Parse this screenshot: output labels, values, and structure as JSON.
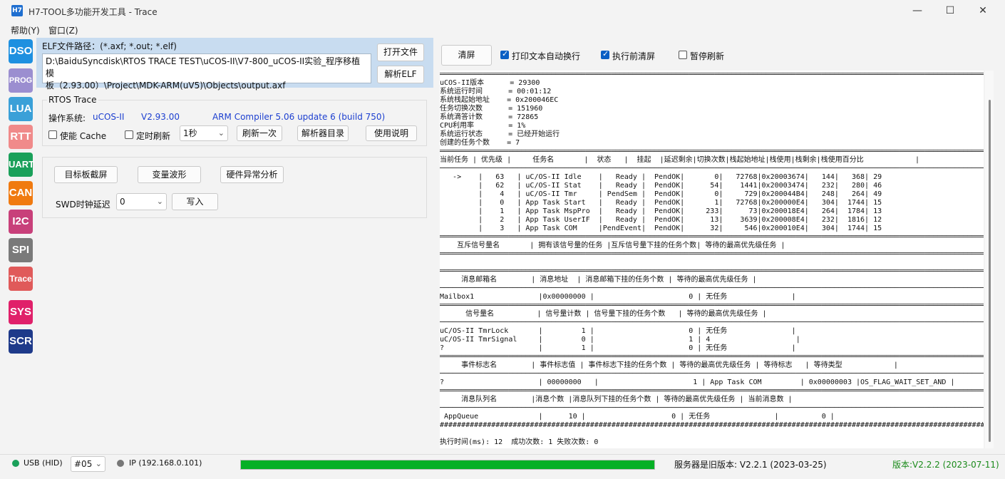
{
  "window": {
    "app_icon": "H7",
    "title": "H7-TOOL多功能开发工具 - Trace",
    "minimize_icon": "minimize-icon",
    "maximize_icon": "maximize-icon",
    "close_icon": "close-icon"
  },
  "menu": [
    "帮助(Y)",
    "窗口(Z)"
  ],
  "sidebar": [
    {
      "label": "DSO",
      "color": "#1e90e0"
    },
    {
      "label": "PROG",
      "color": "#9b8ed0"
    },
    {
      "label": "LUA",
      "color": "#3aa0d8"
    },
    {
      "label": "RTT",
      "color": "#f08a8a"
    },
    {
      "label": "UART",
      "color": "#1aa05a"
    },
    {
      "label": "CAN",
      "color": "#f07a10"
    },
    {
      "label": "I2C",
      "color": "#c8407a"
    },
    {
      "label": "SPI",
      "color": "#7a7a7a"
    },
    {
      "label": "Trace",
      "color": "#e05a5a"
    },
    {
      "label": "SYS",
      "color": "#e0206a"
    },
    {
      "label": "SCR",
      "color": "#1e3a8a"
    }
  ],
  "elf": {
    "label": "ELF文件路径：(*.axf; *.out; *.elf)",
    "path_line1": "D:\\BaiduSyncdisk\\RTOS TRACE TEST\\uCOS-II\\V7-800_uCOS-II实验_程序移植模",
    "path_line2": "板（2.93.00）\\Project\\MDK-ARM(uV5)\\Objects\\output.axf",
    "open_button": "打开文件",
    "parse_button": "解析ELF"
  },
  "rtos": {
    "group_title": "RTOS Trace",
    "os_label": "操作系统:",
    "os_name": "uCOS-II",
    "os_version": "V2.93.00",
    "compiler": "ARM Compiler 5.06 update 6 (build 750)",
    "cache_label": "使能 Cache",
    "timer_label": "定时刷新",
    "interval": "1秒",
    "refresh_button": "刷新一次",
    "parser_dir_button": "解析器目录",
    "help_button": "使用说明"
  },
  "tools": {
    "screenshot_button": "目标板截屏",
    "waveform_button": "变量波形",
    "hardfault_button": "硬件异常分析",
    "swd_label": "SWD时钟延迟",
    "swd_value": "0",
    "write_button": "写入"
  },
  "right_toolbar": {
    "clear_button": "清屏",
    "wrap_label": "打印文本自动换行",
    "wrap_checked": true,
    "clear_before_label": "执行前清屏",
    "clear_before_checked": true,
    "pause_label": "暂停刷新",
    "pause_checked": false
  },
  "console": {
    "lines": [
      "════════════════════════════════════════════════════════════════════════════════════════════════════════════════════════════════════",
      "uCOS-II版本      = 29300",
      "系统运行时间      = 00:01:12",
      "系统栈起始地址    = 0x200046EC",
      "任务切换次数      = 151960",
      "系统滴答计数      = 72865",
      "CPU利用率        = 1%",
      "系统运行状态      = 已经开始运行",
      "创建的任务个数    = 7",
      "════════════════════════════════════════════════════════════════════════════════════════════════════════════════════════════════════",
      "当前任务 | 优先级 |     任务名       |  状态   |  挂起  |延迟剩余|切换次数|栈起始地址|栈使用|栈剩余|栈使用百分比            |",
      "────────────────────────────────────────────────────────────────────────────────────────────────────────────────────────────────────",
      "   ->    |   63   | uC/OS-II Idle    |   Ready |  PendOK|       0|   72768|0x20003674|   144|   368| 29",
      "         |   62   | uC/OS-II Stat    |   Ready |  PendOK|      54|    1441|0x20003474|   232|   280| 46",
      "         |    4   | uC/OS-II Tmr     | PendSem |  PendOK|       0|     729|0x200044B4|   248|   264| 49",
      "         |    0   | App Task Start   |   Ready |  PendOK|       1|   72768|0x200000E4|   304|  1744| 15",
      "         |    1   | App Task MspPro  |   Ready |  PendOK|     233|      73|0x200018E4|   264|  1784| 13",
      "         |    2   | App Task UserIF  |   Ready |  PendOK|      13|    3639|0x200008E4|   232|  1816| 12",
      "         |    3   | App Task COM     |PendEvent|  PendOK|      32|     546|0x200010E4|   304|  1744| 15",
      "════════════════════════════════════════════════════════════════════════════════════════════════════════════════════════════════════",
      "    互斥信号量名       | 拥有该信号量的任务 |互斥信号量下挂的任务个数| 等待的最高优先级任务 |",
      "════════════════════════════════════════════════════════════════════════════════════════════════════════════════════════════════════",
      "",
      "════════════════════════════════════════════════════════════════════════════════════════════════════════════════════════════════════",
      "     消息邮箱名        | 消息地址  | 消息邮箱下挂的任务个数 | 等待的最高优先级任务 |",
      "────────────────────────────────────────────────────────────────────────────────────────────────────────────────────────────────────",
      "Mailbox1               |0x00000000 |                      0 | 无任务               |",
      "════════════════════════════════════════════════════════════════════════════════════════════════════════════════════════════════════",
      "      信号量名          | 信号量计数 | 信号量下挂的任务个数   | 等待的最高优先级任务 |",
      "────────────────────────────────────────────────────────────────────────────────────────────────────────────────────────────────────",
      "uC/OS-II TmrLock       |         1 |                      0 | 无任务               |",
      "uC/OS-II TmrSignal     |         0 |                      1 | 4                    |",
      "?                      |         1 |                      0 | 无任务               |",
      "════════════════════════════════════════════════════════════════════════════════════════════════════════════════════════════════════",
      "     事件标志名        | 事件标志值 | 事件标志下挂的任务个数 | 等待的最高优先级任务 | 等待标志   | 等待类型            |",
      "────────────────────────────────────────────────────────────────────────────────────────────────────────────────────────────────────",
      "?                      | 00000000   |                      1 | App Task COM         | 0x00000003 |OS_FLAG_WAIT_SET_AND |",
      "════════════════════════════════════════════════════════════════════════════════════════════════════════════════════════════════════",
      "     消息队列名        |消息个数 |消息队列下挂的任务个数 | 等待的最高优先级任务 | 当前消息数 |",
      "────────────────────────────────────────────────────────────────────────────────────────────────────────────────────────────────────",
      " AppQueue              |      10 |                    0 | 无任务               |          0 |",
      "####################################################################################################################################",
      "",
      "执行时间(ms): 12  成功次数: 1 失败次数: 0"
    ]
  },
  "status": {
    "usb_label": "USB (HID)",
    "usb_color": "#1aa05a",
    "device": "#05",
    "ip_label": "IP (192.168.0.101)",
    "ip_color": "#777777",
    "progress": 1.0,
    "progress_color": "#06b025",
    "server_version": "服务器是旧版本: V2.2.1 (2023-03-25)",
    "client_version": "版本:V2.2.2 (2023-07-11)",
    "client_version_color": "#1a8a1a"
  }
}
